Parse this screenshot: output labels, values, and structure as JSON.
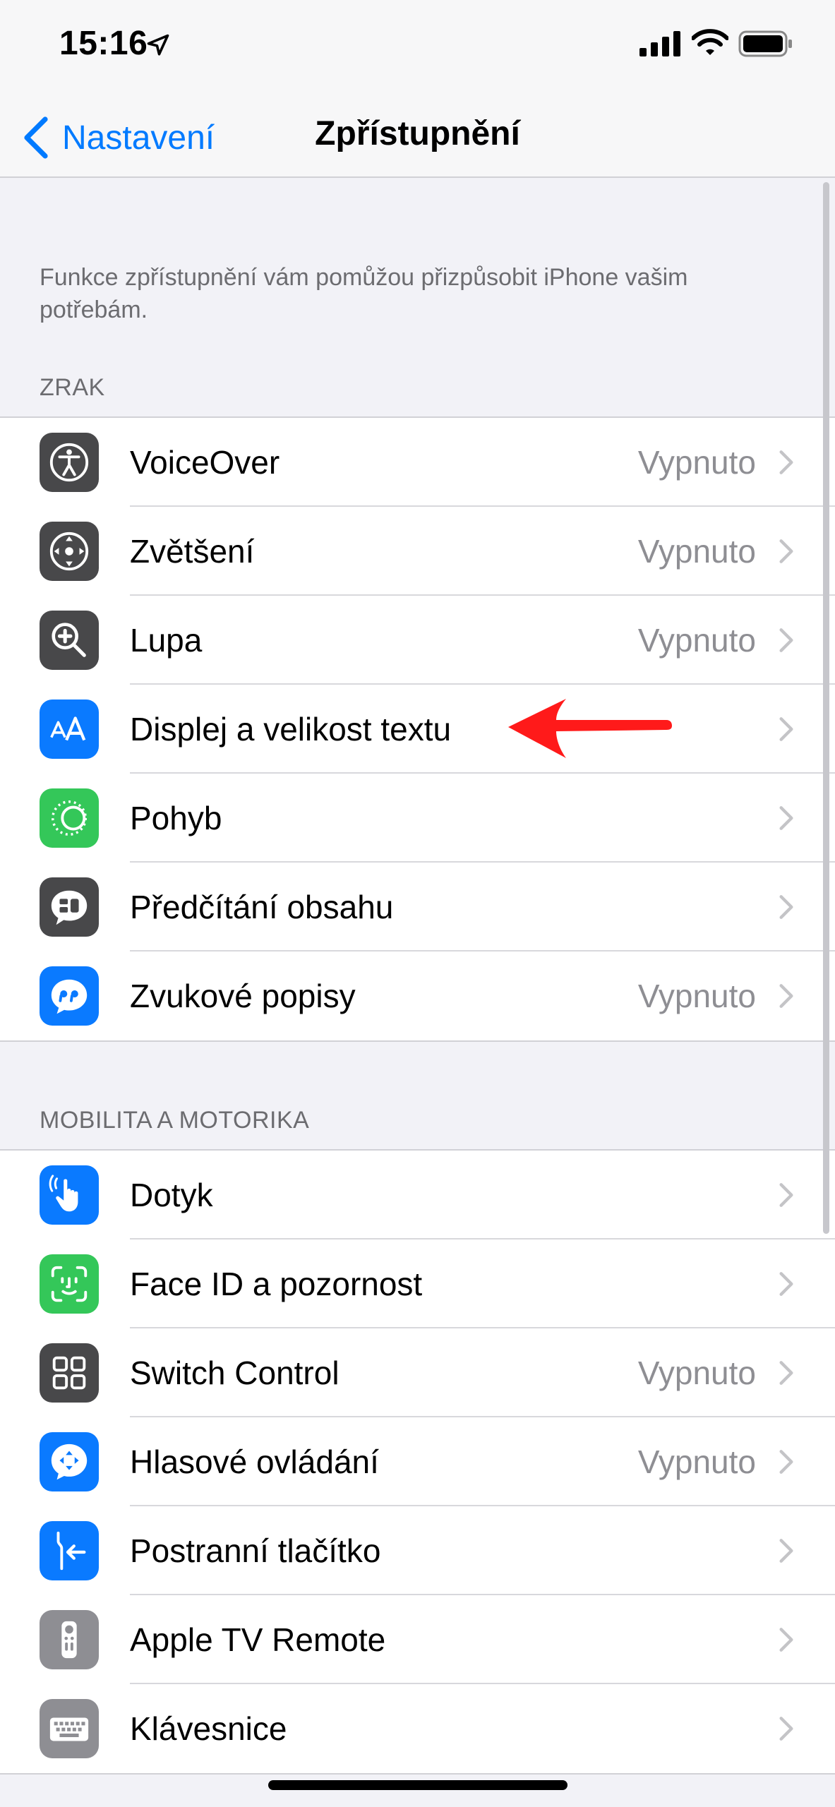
{
  "status_bar": {
    "time": "15:16"
  },
  "nav": {
    "back_label": "Nastavení",
    "title": "Zpřístupnění"
  },
  "intro": "Funkce zpřístupnění vám pomůžou přizpůsobit iPhone vašim potřebám.",
  "sections": [
    {
      "header": "ZRAK",
      "items": [
        {
          "label": "VoiceOver",
          "value": "Vypnuto",
          "icon": "voiceover-icon",
          "color": "#48484a"
        },
        {
          "label": "Zvětšení",
          "value": "Vypnuto",
          "icon": "zoom-icon",
          "color": "#48484a"
        },
        {
          "label": "Lupa",
          "value": "Vypnuto",
          "icon": "magnifier-icon",
          "color": "#48484a"
        },
        {
          "label": "Displej a velikost textu",
          "value": "",
          "icon": "text-size-icon",
          "color": "#0a7aff"
        },
        {
          "label": "Pohyb",
          "value": "",
          "icon": "motion-icon",
          "color": "#34c759"
        },
        {
          "label": "Předčítání obsahu",
          "value": "",
          "icon": "spoken-content-icon",
          "color": "#48484a"
        },
        {
          "label": "Zvukové popisy",
          "value": "Vypnuto",
          "icon": "audio-descriptions-icon",
          "color": "#0a7aff"
        }
      ]
    },
    {
      "header": "MOBILITA A MOTORIKA",
      "items": [
        {
          "label": "Dotyk",
          "value": "",
          "icon": "touch-icon",
          "color": "#0a7aff"
        },
        {
          "label": "Face ID a pozornost",
          "value": "",
          "icon": "face-id-icon",
          "color": "#34c759"
        },
        {
          "label": "Switch Control",
          "value": "Vypnuto",
          "icon": "switch-control-icon",
          "color": "#48484a"
        },
        {
          "label": "Hlasové ovládání",
          "value": "Vypnuto",
          "icon": "voice-control-icon",
          "color": "#0a7aff"
        },
        {
          "label": "Postranní tlačítko",
          "value": "",
          "icon": "side-button-icon",
          "color": "#0a7aff"
        },
        {
          "label": "Apple TV Remote",
          "value": "",
          "icon": "tv-remote-icon",
          "color": "#8e8e93"
        },
        {
          "label": "Klávesnice",
          "value": "",
          "icon": "keyboard-icon",
          "color": "#8e8e93"
        }
      ]
    }
  ],
  "colors": {
    "accent": "#007aff",
    "annotation_arrow": "#ff1a1a"
  }
}
